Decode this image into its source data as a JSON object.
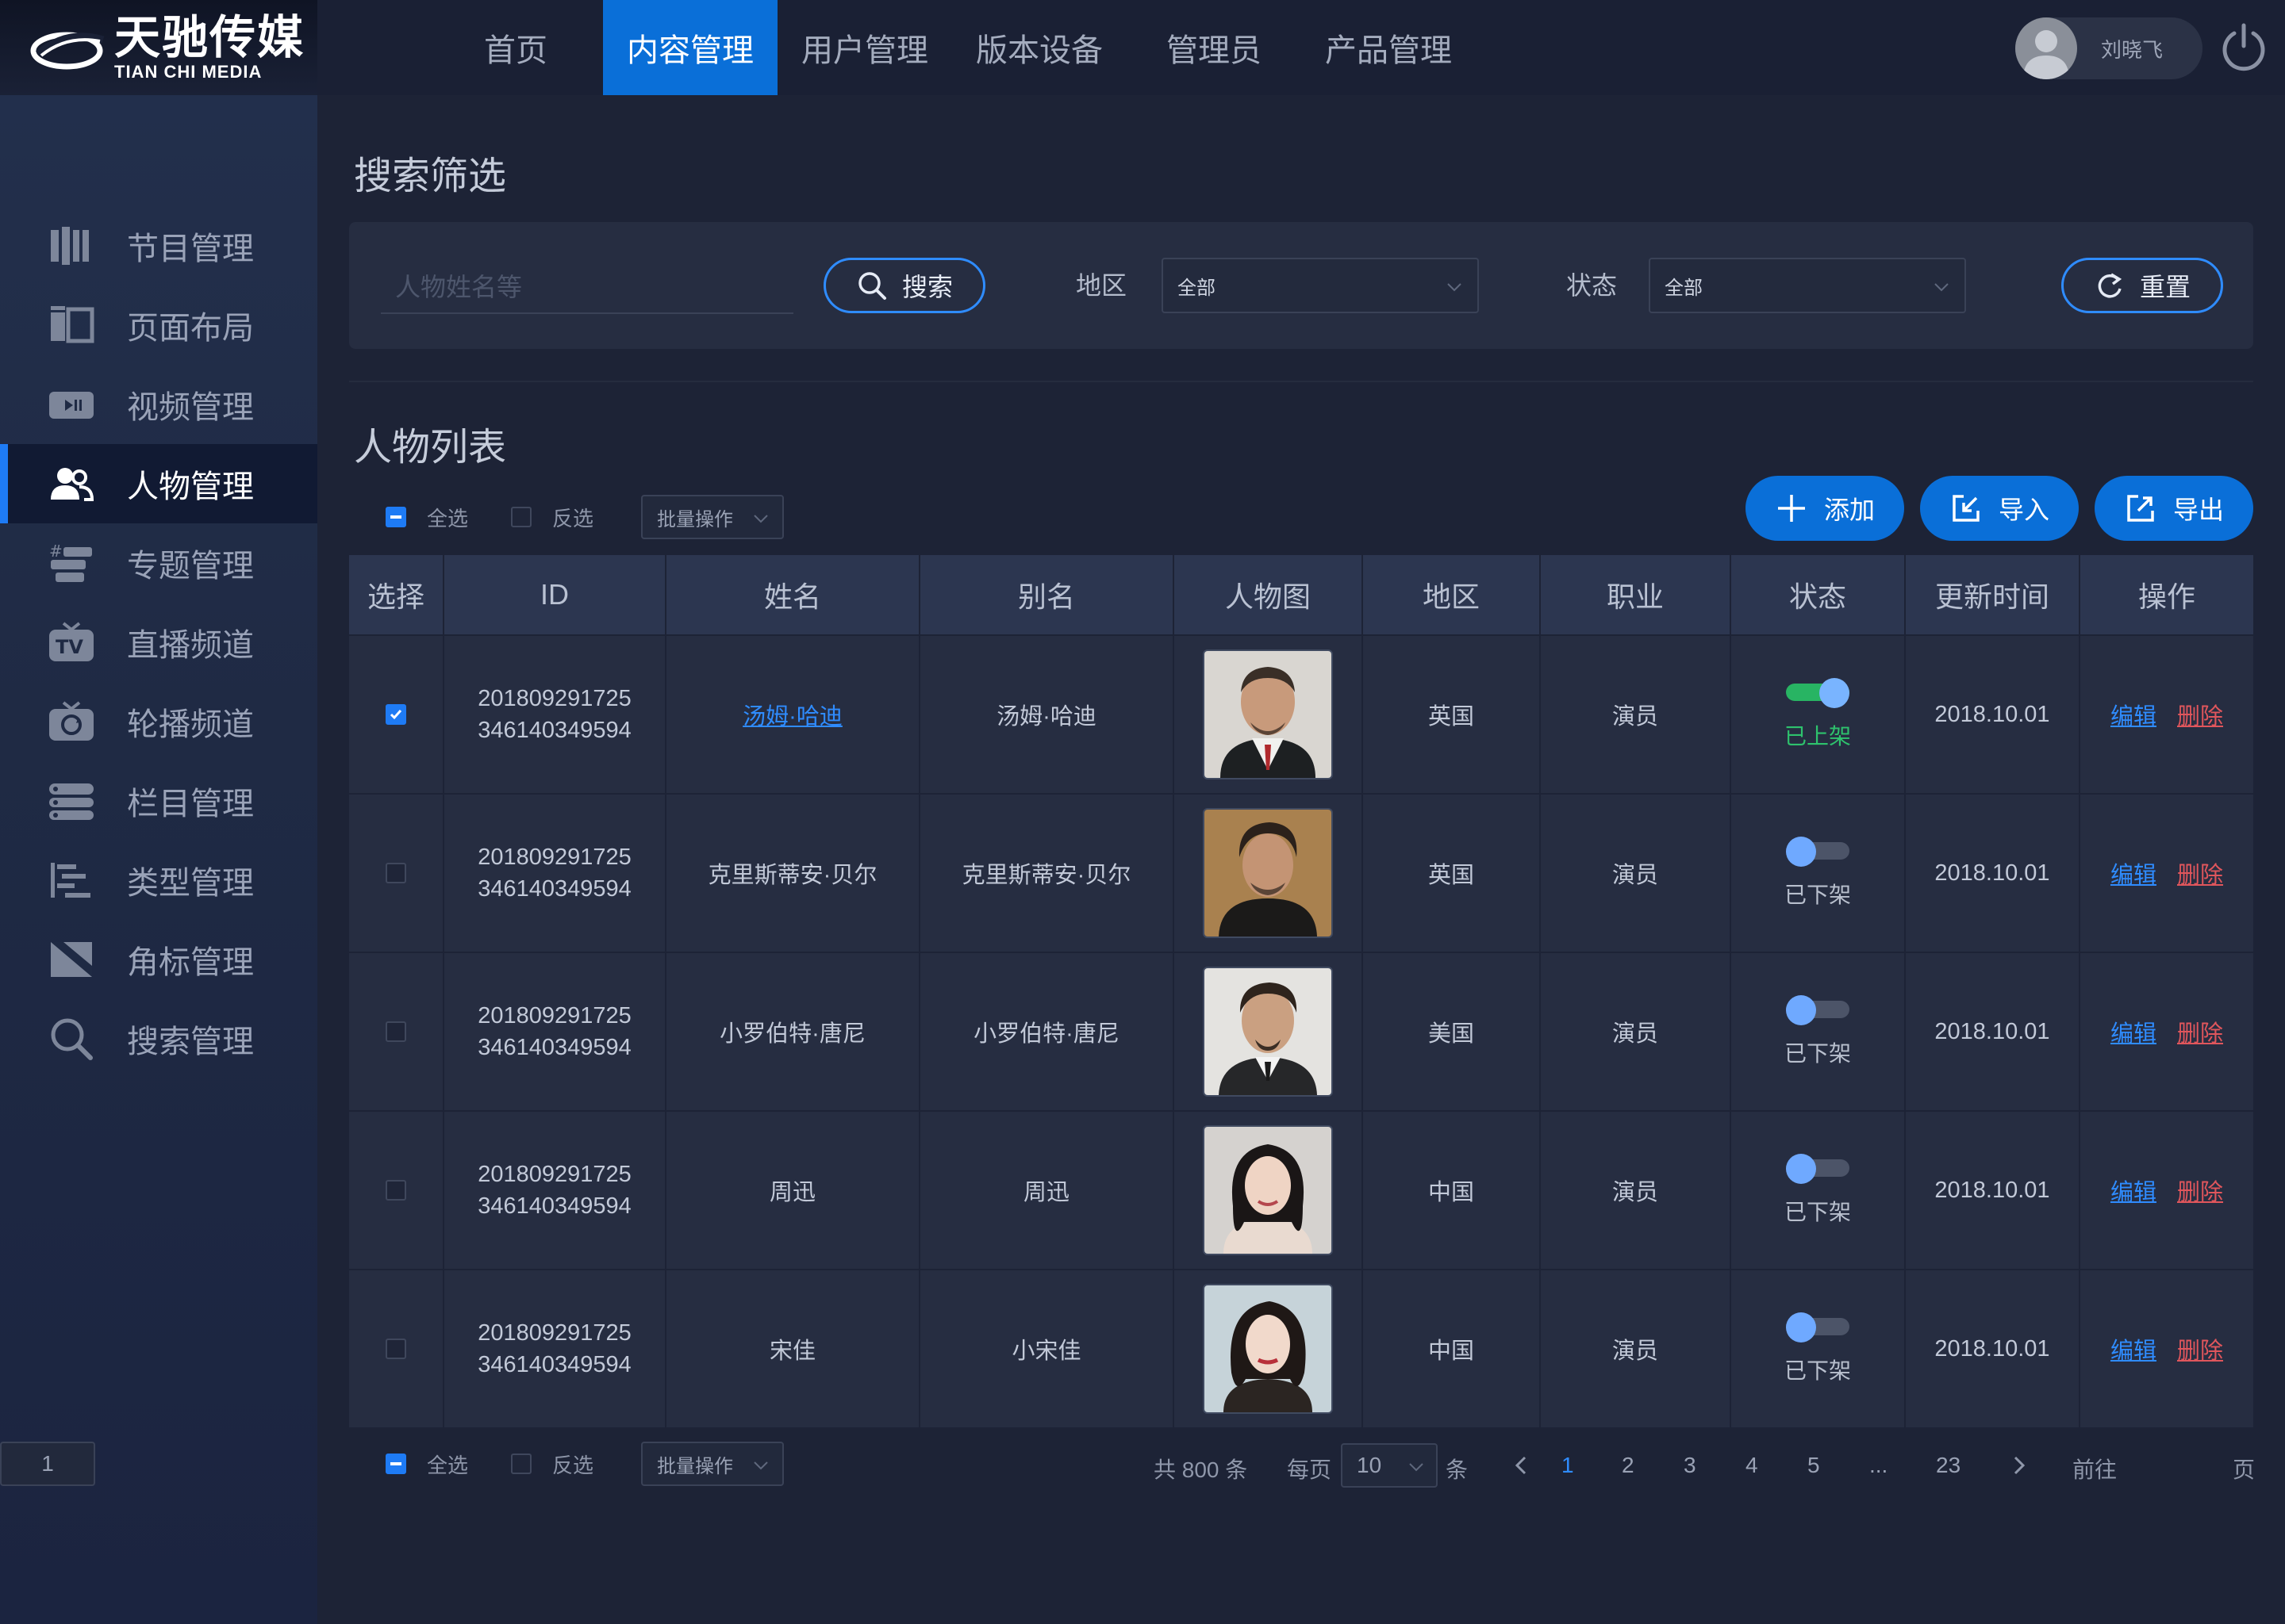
{
  "logo": {
    "cn": "天驰传媒",
    "en": "TIAN CHI MEDIA"
  },
  "sidebar": {
    "items": [
      {
        "label": "节目管理",
        "icon": "program-icon",
        "active": false
      },
      {
        "label": "页面布局",
        "icon": "layout-icon",
        "active": false
      },
      {
        "label": "视频管理",
        "icon": "video-icon",
        "active": false
      },
      {
        "label": "人物管理",
        "icon": "people-icon",
        "active": true
      },
      {
        "label": "专题管理",
        "icon": "topic-icon",
        "active": false
      },
      {
        "label": "直播频道",
        "icon": "tv-icon",
        "active": false
      },
      {
        "label": "轮播频道",
        "icon": "carousel-icon",
        "active": false
      },
      {
        "label": "栏目管理",
        "icon": "column-icon",
        "active": false
      },
      {
        "label": "类型管理",
        "icon": "type-icon",
        "active": false
      },
      {
        "label": "角标管理",
        "icon": "corner-mark-icon",
        "active": false
      },
      {
        "label": "搜索管理",
        "icon": "search-icon",
        "active": false
      }
    ]
  },
  "topnav": {
    "items": [
      "首页",
      "内容管理",
      "用户管理",
      "版本设备",
      "管理员",
      "产品管理"
    ],
    "active_index": 1
  },
  "user": {
    "name": "刘晓飞"
  },
  "filter": {
    "title": "搜索筛选",
    "search_placeholder": "人物姓名等",
    "search_button": "搜索",
    "region_label": "地区",
    "region_value": "全部",
    "status_label": "状态",
    "status_value": "全部",
    "reset_button": "重置"
  },
  "list": {
    "title": "人物列表",
    "select_all": "全选",
    "invert": "反选",
    "batch": "批量操作",
    "add": "添加",
    "import": "导入",
    "export": "导出"
  },
  "table": {
    "headers": [
      "选择",
      "ID",
      "姓名",
      "别名",
      "人物图",
      "地区",
      "职业",
      "状态",
      "更新时间",
      "操作"
    ],
    "rows": [
      {
        "checked": true,
        "id_line1": "201809291725",
        "id_line2": "346140349594",
        "name": "汤姆·哈迪",
        "name_link": true,
        "alias": "汤姆·哈迪",
        "photo": "portrait-tom-hardy",
        "region": "英国",
        "job": "演员",
        "status_on": true,
        "status": "已上架",
        "updated": "2018.10.01",
        "edit": "编辑",
        "delete": "删除"
      },
      {
        "checked": false,
        "id_line1": "201809291725",
        "id_line2": "346140349594",
        "name": "克里斯蒂安·贝尔",
        "name_link": false,
        "alias": "克里斯蒂安·贝尔",
        "photo": "portrait-christian-bale",
        "region": "英国",
        "job": "演员",
        "status_on": false,
        "status": "已下架",
        "updated": "2018.10.01",
        "edit": "编辑",
        "delete": "删除"
      },
      {
        "checked": false,
        "id_line1": "201809291725",
        "id_line2": "346140349594",
        "name": "小罗伯特·唐尼",
        "name_link": false,
        "alias": "小罗伯特·唐尼",
        "photo": "portrait-robert-downey",
        "region": "美国",
        "job": "演员",
        "status_on": false,
        "status": "已下架",
        "updated": "2018.10.01",
        "edit": "编辑",
        "delete": "删除"
      },
      {
        "checked": false,
        "id_line1": "201809291725",
        "id_line2": "346140349594",
        "name": "周迅",
        "name_link": false,
        "alias": "周迅",
        "photo": "portrait-zhou-xun",
        "region": "中国",
        "job": "演员",
        "status_on": false,
        "status": "已下架",
        "updated": "2018.10.01",
        "edit": "编辑",
        "delete": "删除"
      },
      {
        "checked": false,
        "id_line1": "201809291725",
        "id_line2": "346140349594",
        "name": "宋佳",
        "name_link": false,
        "alias": "小宋佳",
        "photo": "portrait-song-jia",
        "region": "中国",
        "job": "演员",
        "status_on": false,
        "status": "已下架",
        "updated": "2018.10.01",
        "edit": "编辑",
        "delete": "删除"
      }
    ]
  },
  "pager": {
    "total": "共 800 条",
    "per_page_label": "每页",
    "per_page_value": "10",
    "per_page_unit": "条",
    "pages": [
      "1",
      "2",
      "3",
      "4",
      "5",
      "...",
      "23"
    ],
    "current_page": "1",
    "goto_label": "前往",
    "goto_value": "1",
    "goto_unit": "页"
  },
  "colors": {
    "accent": "#0a6fd8",
    "link": "#2f8cff",
    "danger": "#e0565c",
    "success": "#2ec26d"
  }
}
